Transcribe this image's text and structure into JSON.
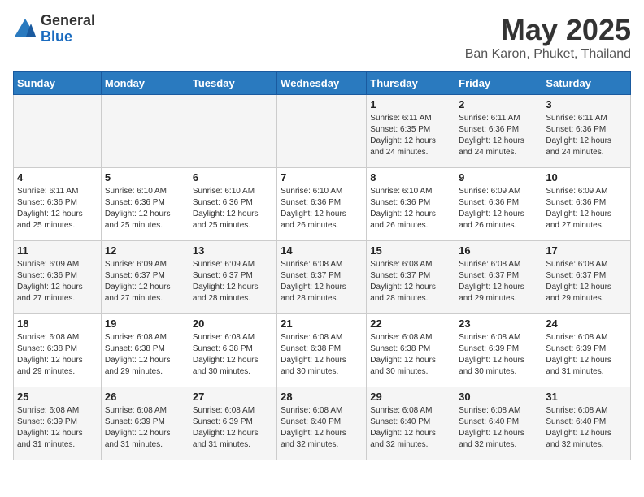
{
  "header": {
    "logo_line1": "General",
    "logo_line2": "Blue",
    "title": "May 2025",
    "subtitle": "Ban Karon, Phuket, Thailand"
  },
  "weekdays": [
    "Sunday",
    "Monday",
    "Tuesday",
    "Wednesday",
    "Thursday",
    "Friday",
    "Saturday"
  ],
  "weeks": [
    [
      {
        "day": "",
        "info": ""
      },
      {
        "day": "",
        "info": ""
      },
      {
        "day": "",
        "info": ""
      },
      {
        "day": "",
        "info": ""
      },
      {
        "day": "1",
        "info": "Sunrise: 6:11 AM\nSunset: 6:35 PM\nDaylight: 12 hours\nand 24 minutes."
      },
      {
        "day": "2",
        "info": "Sunrise: 6:11 AM\nSunset: 6:36 PM\nDaylight: 12 hours\nand 24 minutes."
      },
      {
        "day": "3",
        "info": "Sunrise: 6:11 AM\nSunset: 6:36 PM\nDaylight: 12 hours\nand 24 minutes."
      }
    ],
    [
      {
        "day": "4",
        "info": "Sunrise: 6:11 AM\nSunset: 6:36 PM\nDaylight: 12 hours\nand 25 minutes."
      },
      {
        "day": "5",
        "info": "Sunrise: 6:10 AM\nSunset: 6:36 PM\nDaylight: 12 hours\nand 25 minutes."
      },
      {
        "day": "6",
        "info": "Sunrise: 6:10 AM\nSunset: 6:36 PM\nDaylight: 12 hours\nand 25 minutes."
      },
      {
        "day": "7",
        "info": "Sunrise: 6:10 AM\nSunset: 6:36 PM\nDaylight: 12 hours\nand 26 minutes."
      },
      {
        "day": "8",
        "info": "Sunrise: 6:10 AM\nSunset: 6:36 PM\nDaylight: 12 hours\nand 26 minutes."
      },
      {
        "day": "9",
        "info": "Sunrise: 6:09 AM\nSunset: 6:36 PM\nDaylight: 12 hours\nand 26 minutes."
      },
      {
        "day": "10",
        "info": "Sunrise: 6:09 AM\nSunset: 6:36 PM\nDaylight: 12 hours\nand 27 minutes."
      }
    ],
    [
      {
        "day": "11",
        "info": "Sunrise: 6:09 AM\nSunset: 6:36 PM\nDaylight: 12 hours\nand 27 minutes."
      },
      {
        "day": "12",
        "info": "Sunrise: 6:09 AM\nSunset: 6:37 PM\nDaylight: 12 hours\nand 27 minutes."
      },
      {
        "day": "13",
        "info": "Sunrise: 6:09 AM\nSunset: 6:37 PM\nDaylight: 12 hours\nand 28 minutes."
      },
      {
        "day": "14",
        "info": "Sunrise: 6:08 AM\nSunset: 6:37 PM\nDaylight: 12 hours\nand 28 minutes."
      },
      {
        "day": "15",
        "info": "Sunrise: 6:08 AM\nSunset: 6:37 PM\nDaylight: 12 hours\nand 28 minutes."
      },
      {
        "day": "16",
        "info": "Sunrise: 6:08 AM\nSunset: 6:37 PM\nDaylight: 12 hours\nand 29 minutes."
      },
      {
        "day": "17",
        "info": "Sunrise: 6:08 AM\nSunset: 6:37 PM\nDaylight: 12 hours\nand 29 minutes."
      }
    ],
    [
      {
        "day": "18",
        "info": "Sunrise: 6:08 AM\nSunset: 6:38 PM\nDaylight: 12 hours\nand 29 minutes."
      },
      {
        "day": "19",
        "info": "Sunrise: 6:08 AM\nSunset: 6:38 PM\nDaylight: 12 hours\nand 29 minutes."
      },
      {
        "day": "20",
        "info": "Sunrise: 6:08 AM\nSunset: 6:38 PM\nDaylight: 12 hours\nand 30 minutes."
      },
      {
        "day": "21",
        "info": "Sunrise: 6:08 AM\nSunset: 6:38 PM\nDaylight: 12 hours\nand 30 minutes."
      },
      {
        "day": "22",
        "info": "Sunrise: 6:08 AM\nSunset: 6:38 PM\nDaylight: 12 hours\nand 30 minutes."
      },
      {
        "day": "23",
        "info": "Sunrise: 6:08 AM\nSunset: 6:39 PM\nDaylight: 12 hours\nand 30 minutes."
      },
      {
        "day": "24",
        "info": "Sunrise: 6:08 AM\nSunset: 6:39 PM\nDaylight: 12 hours\nand 31 minutes."
      }
    ],
    [
      {
        "day": "25",
        "info": "Sunrise: 6:08 AM\nSunset: 6:39 PM\nDaylight: 12 hours\nand 31 minutes."
      },
      {
        "day": "26",
        "info": "Sunrise: 6:08 AM\nSunset: 6:39 PM\nDaylight: 12 hours\nand 31 minutes."
      },
      {
        "day": "27",
        "info": "Sunrise: 6:08 AM\nSunset: 6:39 PM\nDaylight: 12 hours\nand 31 minutes."
      },
      {
        "day": "28",
        "info": "Sunrise: 6:08 AM\nSunset: 6:40 PM\nDaylight: 12 hours\nand 32 minutes."
      },
      {
        "day": "29",
        "info": "Sunrise: 6:08 AM\nSunset: 6:40 PM\nDaylight: 12 hours\nand 32 minutes."
      },
      {
        "day": "30",
        "info": "Sunrise: 6:08 AM\nSunset: 6:40 PM\nDaylight: 12 hours\nand 32 minutes."
      },
      {
        "day": "31",
        "info": "Sunrise: 6:08 AM\nSunset: 6:40 PM\nDaylight: 12 hours\nand 32 minutes."
      }
    ]
  ]
}
